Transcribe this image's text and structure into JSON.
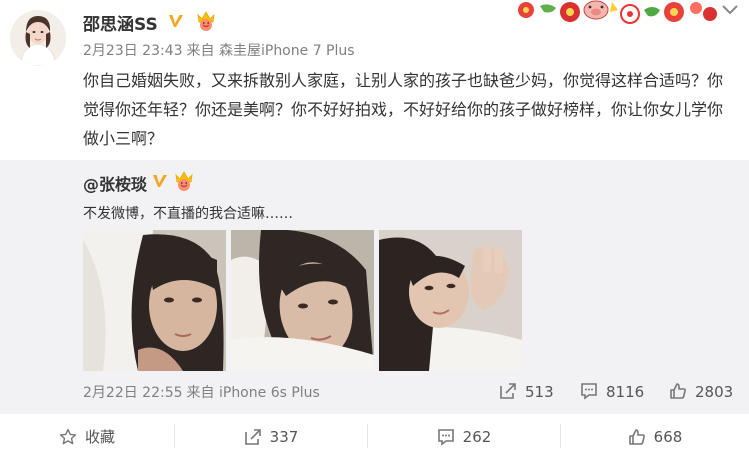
{
  "post": {
    "author": "邵思涵SS",
    "date": "2月23日 23:43",
    "source": "来自 森圭屋iPhone 7 Plus",
    "text": "你自己婚姻失败，又来拆散别人家庭，让别人家的孩子也缺爸少妈，你觉得这样合适吗？你觉得你还年轻？你还是美啊？你不好好拍戏，不好好给你的孩子做好榜样，你让你女儿学你做小三啊？"
  },
  "repost": {
    "author": "@张桉琰",
    "text": "不发微博，不直播的我合适嘛……",
    "date": "2月22日 22:55",
    "source": "来自 iPhone 6s Plus",
    "shares": "513",
    "comments": "8116",
    "likes": "2803"
  },
  "footer": {
    "favorite_label": "收藏",
    "shares": "337",
    "comments": "262",
    "likes": "668"
  },
  "colors": {
    "verified_gold": "#f5a623",
    "meta_gray": "#808080",
    "repost_bg": "#f2f2f5"
  },
  "icons": [
    "v-verified-icon",
    "vip-crown-icon",
    "festive-decoration",
    "chevron-down-icon",
    "share-icon",
    "comment-icon",
    "like-icon",
    "star-icon"
  ]
}
